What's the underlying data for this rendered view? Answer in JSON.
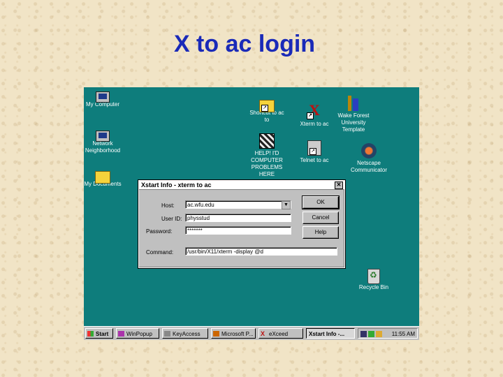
{
  "slide": {
    "title": "X to ac login"
  },
  "desktop": {
    "icons": [
      {
        "label": "My Computer"
      },
      {
        "label": "Network Neighborhood"
      },
      {
        "label": "My Documents"
      },
      {
        "label": "Shortcut to ac to"
      },
      {
        "label": "Xterm to ac"
      },
      {
        "label": "Wake Forest University Template"
      },
      {
        "label": "HELP! I'D COMPUTER PROBLEMS HERE"
      },
      {
        "label": "Telnet to ac"
      },
      {
        "label": "Netscape Communicator"
      },
      {
        "label": "Recycle Bin"
      }
    ]
  },
  "dialog": {
    "title": "Xstart Info - xterm to ac",
    "host_label": "Host:",
    "host_value": "ac.wfu.edu",
    "userid_label": "User ID:",
    "userid_value": "physstud",
    "password_label": "Password:",
    "password_value": "*******",
    "command_label": "Command:",
    "command_value": "/usr/bin/X11/xterm -display @d",
    "ok_label": "OK",
    "cancel_label": "Cancel",
    "help_label": "Help",
    "close_glyph": "✕"
  },
  "taskbar": {
    "start_label": "Start",
    "items": [
      {
        "label": "WinPopup"
      },
      {
        "label": "KeyAccess"
      },
      {
        "label": "Microsoft P..."
      },
      {
        "label": "eXceed"
      },
      {
        "label": "Xstart Info -..."
      }
    ],
    "clock": "11:55 AM"
  }
}
